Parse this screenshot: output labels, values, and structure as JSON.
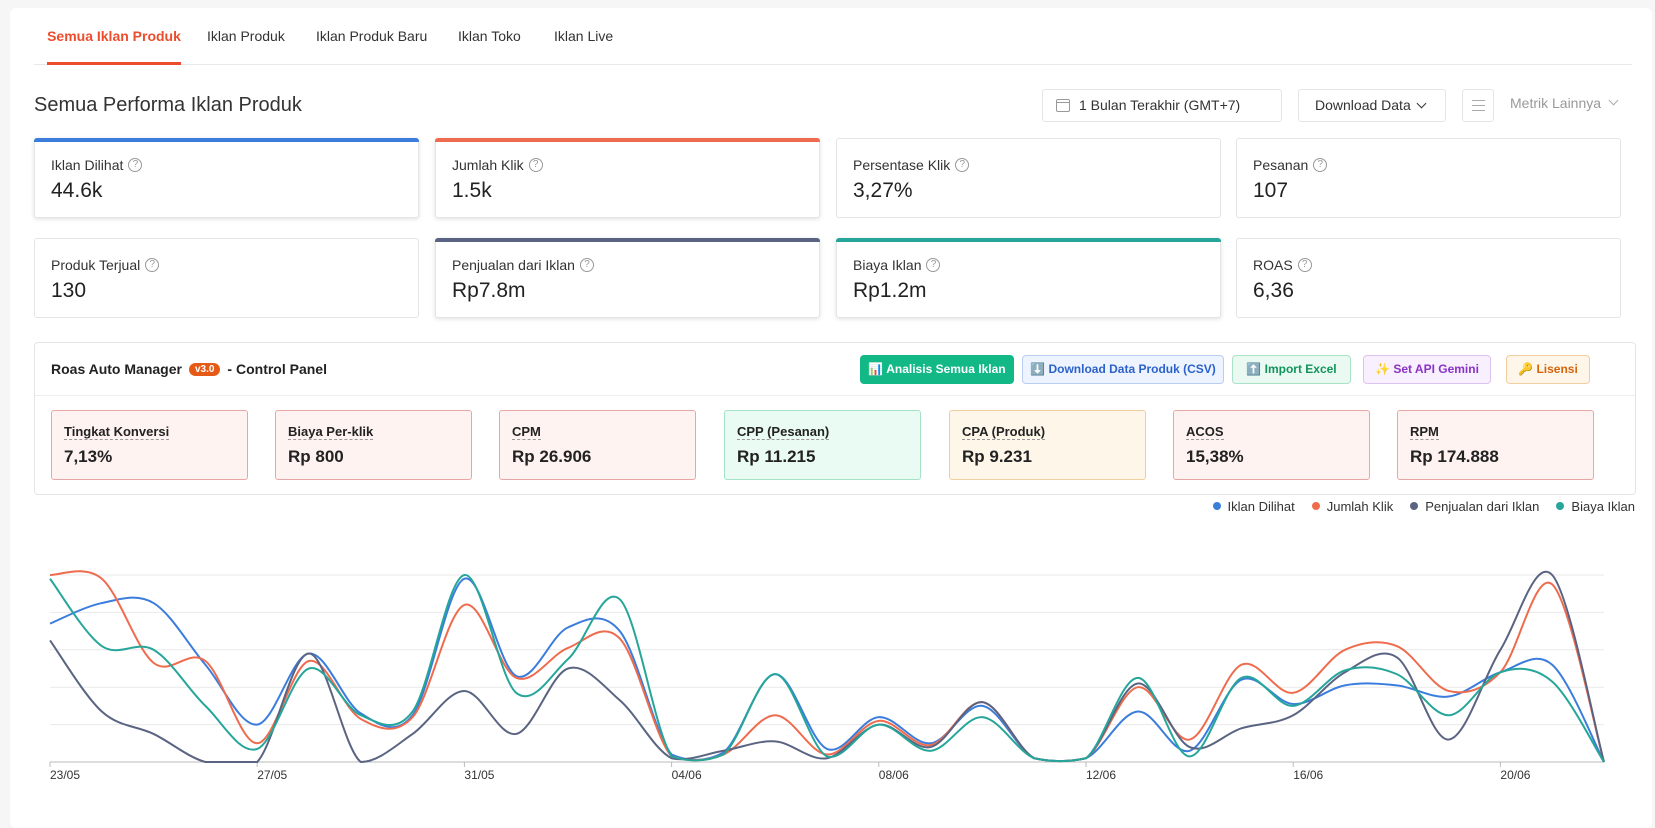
{
  "tabs": [
    "Semua Iklan Produk",
    "Iklan Produk",
    "Iklan Produk Baru",
    "Iklan Toko",
    "Iklan Live"
  ],
  "header": {
    "title": "Semua Performa Iklan Produk",
    "date_range": "1 Bulan Terakhir (GMT+7)",
    "download_label": "Download Data",
    "more_metrics": "Metrik Lainnya"
  },
  "cards": [
    {
      "label": "Iklan Dilihat",
      "value": "44.6k",
      "accent": "#3b7ddd"
    },
    {
      "label": "Jumlah Klik",
      "value": "1.5k",
      "accent": "#ee6c4d"
    },
    {
      "label": "Persentase Klik",
      "value": "3,27%",
      "accent": ""
    },
    {
      "label": "Pesanan",
      "value": "107",
      "accent": ""
    },
    {
      "label": "Produk Terjual",
      "value": "130",
      "accent": ""
    },
    {
      "label": "Penjualan dari Iklan",
      "value": "Rp7.8m",
      "accent": "#5a6482"
    },
    {
      "label": "Biaya Iklan",
      "value": "Rp1.2m",
      "accent": "#26a69a"
    },
    {
      "label": "ROAS",
      "value": "6,36",
      "accent": ""
    }
  ],
  "ram": {
    "title": "Roas Auto Manager",
    "version": "v3.0",
    "subtitle": "- Control Panel",
    "buttons": [
      {
        "label": "📊 Analisis Semua Iklan",
        "bg": "#12b886",
        "fg": "#ffffff",
        "border": "#12b886"
      },
      {
        "label": "⬇️ Download Data Produk (CSV)",
        "bg": "#eef4ff",
        "fg": "#2b62c9",
        "border": "#b9cdf2"
      },
      {
        "label": "⬆️ Import Excel",
        "bg": "#eafaf2",
        "fg": "#12935c",
        "border": "#a9e2c5"
      },
      {
        "label": "✨ Set API Gemini",
        "bg": "#f8efff",
        "fg": "#8a32c4",
        "border": "#dcc3ef"
      },
      {
        "label": "🔑 Lisensi",
        "bg": "#fff6ea",
        "fg": "#d4640c",
        "border": "#f1cd9f"
      }
    ],
    "metrics": [
      {
        "label": "Tingkat Konversi",
        "value": "7,13%",
        "bg": "#fff3f1",
        "border": "#e8a7a7"
      },
      {
        "label": "Biaya Per-klik",
        "value": "Rp 800",
        "bg": "#fff3f1",
        "border": "#e8a7a7"
      },
      {
        "label": "CPM",
        "value": "Rp 26.906",
        "bg": "#fff3f1",
        "border": "#e8a7a7"
      },
      {
        "label": "CPP (Pesanan)",
        "value": "Rp 11.215",
        "bg": "#e9fbf3",
        "border": "#a4e3c6"
      },
      {
        "label": "CPA (Produk)",
        "value": "Rp 9.231",
        "bg": "#fff6ea",
        "border": "#f0cf9f"
      },
      {
        "label": "ACOS",
        "value": "15,38%",
        "bg": "#fff3f1",
        "border": "#e8a7a7"
      },
      {
        "label": "RPM",
        "value": "Rp 174.888",
        "bg": "#fff3f1",
        "border": "#e8a7a7"
      }
    ]
  },
  "chart_data": {
    "type": "line",
    "x": [
      "23/05",
      "24/05",
      "25/05",
      "26/05",
      "27/05",
      "28/05",
      "29/05",
      "30/05",
      "31/05",
      "01/06",
      "02/06",
      "03/06",
      "04/06",
      "05/06",
      "06/06",
      "07/06",
      "08/06",
      "09/06",
      "10/06",
      "11/06",
      "12/06",
      "13/06",
      "14/06",
      "15/06",
      "16/06",
      "17/06",
      "18/06",
      "19/06",
      "20/06",
      "21/06",
      "22/06"
    ],
    "tick_labels": [
      "23/05",
      "27/05",
      "31/05",
      "04/06",
      "08/06",
      "12/06",
      "16/06",
      "20/06"
    ],
    "ylim": [
      0,
      1
    ],
    "grid": true,
    "legend_position": "top-right",
    "series": [
      {
        "name": "Iklan Dilihat",
        "color": "#3b7ddd",
        "values": [
          0.74,
          0.85,
          0.85,
          0.52,
          0.2,
          0.58,
          0.26,
          0.25,
          0.98,
          0.46,
          0.72,
          0.7,
          0.04,
          0.05,
          0.47,
          0.07,
          0.24,
          0.1,
          0.3,
          0.02,
          0.02,
          0.27,
          0.06,
          0.44,
          0.31,
          0.41,
          0.41,
          0.35,
          0.48,
          0.52,
          0.0
        ]
      },
      {
        "name": "Jumlah Klik",
        "color": "#ee6c4d",
        "values": [
          1.0,
          0.98,
          0.53,
          0.54,
          0.1,
          0.54,
          0.23,
          0.24,
          0.84,
          0.45,
          0.61,
          0.66,
          0.03,
          0.04,
          0.25,
          0.04,
          0.22,
          0.09,
          0.32,
          0.02,
          0.02,
          0.4,
          0.12,
          0.52,
          0.37,
          0.6,
          0.62,
          0.38,
          0.48,
          0.95,
          0.0
        ]
      },
      {
        "name": "Penjualan dari Iklan",
        "color": "#5a6482",
        "values": [
          0.65,
          0.27,
          0.15,
          0.0,
          0.0,
          0.58,
          0.0,
          0.15,
          0.38,
          0.15,
          0.5,
          0.33,
          0.02,
          0.06,
          0.11,
          0.02,
          0.2,
          0.08,
          0.32,
          0.02,
          0.02,
          0.42,
          0.08,
          0.18,
          0.25,
          0.48,
          0.56,
          0.12,
          0.6,
          1.0,
          0.0
        ]
      },
      {
        "name": "Biaya Iklan",
        "color": "#26a69a",
        "values": [
          0.98,
          0.62,
          0.6,
          0.3,
          0.07,
          0.5,
          0.25,
          0.27,
          1.0,
          0.37,
          0.55,
          0.87,
          0.03,
          0.04,
          0.47,
          0.03,
          0.2,
          0.06,
          0.24,
          0.02,
          0.02,
          0.45,
          0.03,
          0.45,
          0.3,
          0.49,
          0.47,
          0.25,
          0.48,
          0.43,
          0.0
        ]
      }
    ]
  }
}
